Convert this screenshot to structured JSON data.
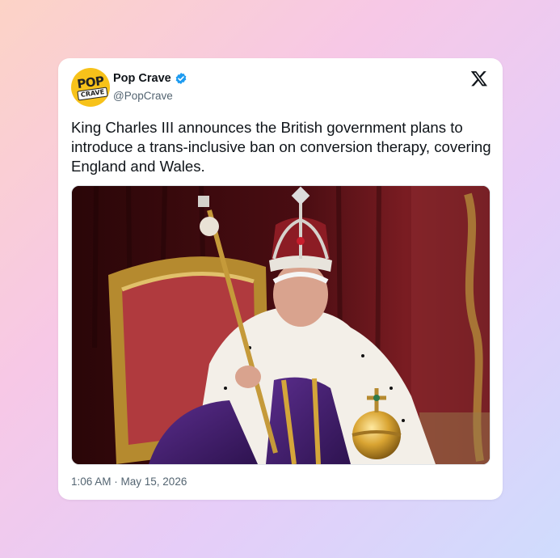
{
  "author": {
    "display_name": "Pop Crave",
    "handle": "@PopCrave",
    "verified": true,
    "avatar_text_top": "POP",
    "avatar_text_bottom": "CRAVE"
  },
  "tweet": {
    "text": "King Charles III announces the British government plans to introduce a trans-inclusive ban on conversion therapy, covering England and Wales.",
    "timestamp": "1:06 AM · May 15, 2026"
  },
  "icons": {
    "platform": "x-logo-icon",
    "verified": "verified-badge-icon"
  },
  "colors": {
    "verified_blue": "#1d9bf0",
    "text_primary": "#0f1419",
    "text_secondary": "#536471",
    "avatar_yellow": "#f7c21a"
  }
}
